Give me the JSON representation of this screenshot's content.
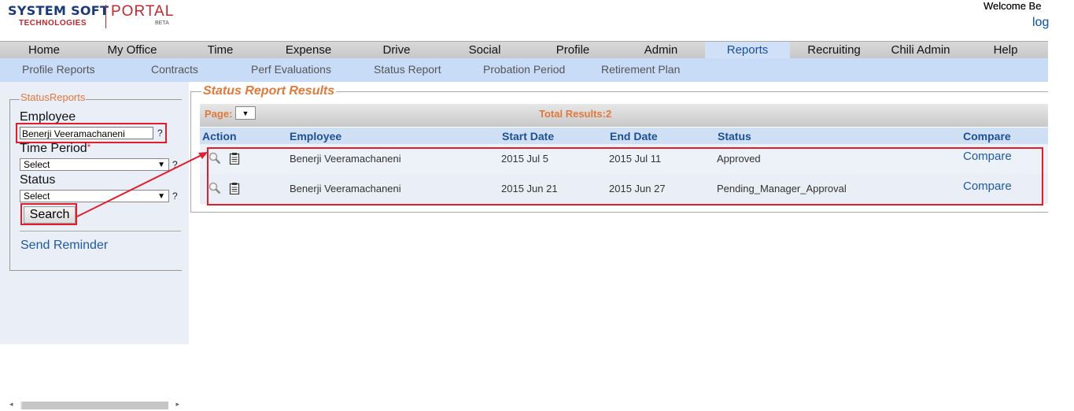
{
  "brand": {
    "company": "SYSTEM SOFT",
    "company_sub": "TECHNOLOGIES",
    "portal": "PORTAL",
    "beta": "BETA"
  },
  "header": {
    "welcome": "Welcome Be",
    "logout": "log"
  },
  "nav": {
    "tabs": [
      {
        "label": "Home"
      },
      {
        "label": "My Office"
      },
      {
        "label": "Time"
      },
      {
        "label": "Expense"
      },
      {
        "label": "Drive"
      },
      {
        "label": "Social"
      },
      {
        "label": "Profile"
      },
      {
        "label": "Admin"
      },
      {
        "label": "Reports",
        "active": true
      },
      {
        "label": "Recruiting"
      },
      {
        "label": "Chili Admin"
      },
      {
        "label": "Help"
      }
    ]
  },
  "subnav": {
    "items": [
      {
        "label": "Profile Reports"
      },
      {
        "label": "Contracts"
      },
      {
        "label": "Perf Evaluations"
      },
      {
        "label": "Status Report"
      },
      {
        "label": "Probation Period"
      },
      {
        "label": "Retirement Plan"
      }
    ]
  },
  "sidebar": {
    "legend": "StatusReports",
    "employee_label": "Employee",
    "employee_value": "Benerji Veeramachaneni",
    "help": "?",
    "time_period_label": "Time Period",
    "required_mark": "*",
    "time_period_value": "Select",
    "status_label": "Status",
    "status_value": "Select",
    "search_label": "Search",
    "send_reminder": "Send Reminder"
  },
  "results": {
    "title": "Status Report Results",
    "page_label": "Page:",
    "total": "Total Results:2",
    "columns": [
      "Action",
      "Employee",
      "Start Date",
      "End Date",
      "Status",
      "Compare"
    ],
    "rows": [
      {
        "employee": "Benerji Veeramachaneni",
        "start": "2015 Jul 5",
        "end": "2015 Jul 11",
        "status": "Approved",
        "compare": "Compare"
      },
      {
        "employee": "Benerji Veeramachaneni",
        "start": "2015 Jun 21",
        "end": "2015 Jun 27",
        "status": "Pending_Manager_Approval",
        "compare": "Compare"
      }
    ]
  },
  "colors": {
    "accent_orange": "#e0793a",
    "link_blue": "#1e5aa8",
    "highlight_red": "#e21d2c",
    "active_tab_bg": "#cfe0f7"
  }
}
